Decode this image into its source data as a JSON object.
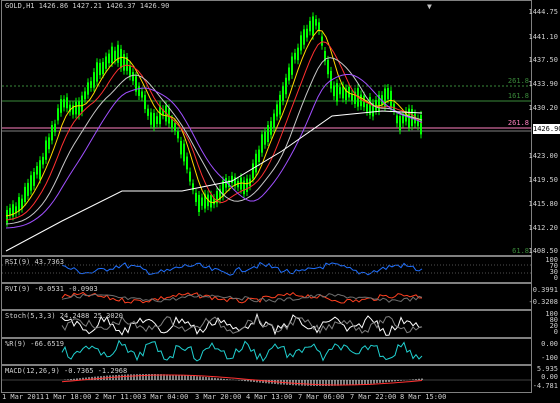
{
  "window": {
    "symbol_line": "GOLD,H1  1426.86 1427.21 1426.37 1426.90"
  },
  "price_axis": {
    "labels": [
      "1444.75",
      "1441.10",
      "1437.50",
      "1433.90",
      "1430.20",
      "1426.90",
      "1423.00",
      "1419.50",
      "1415.80",
      "1412.20",
      "1408.50"
    ],
    "current_price": "1426.90"
  },
  "fib_levels": {
    "top": "261.8",
    "mid": "161.8",
    "lower": "261.8",
    "bottom": "61.8"
  },
  "indicators": {
    "rsi": {
      "label": "RSI(9) 43.7363",
      "axis": [
        "100",
        "70",
        "30",
        "0"
      ]
    },
    "rvi": {
      "label": "RVI(9) -0.0531 -0.0903",
      "axis": [
        "0.3991",
        "-0.3208"
      ]
    },
    "stoch": {
      "label": "Stoch(5,3,3) 24.2488 25.3020",
      "axis": [
        "100",
        "80",
        "20",
        "0"
      ]
    },
    "wpr": {
      "label": "%R(9) -66.6519",
      "axis": [
        "0.00",
        "-100"
      ]
    },
    "macd": {
      "label": "MACD(12,26,9) -0.7365 -1.2968",
      "axis": [
        "5.935",
        "0.00",
        "-4.781"
      ]
    }
  },
  "time_axis": [
    "1 Mar 2011",
    "1 Mar 18:00",
    "2 Mar 11:00",
    "3 Mar 04:00",
    "3 Mar 20:00",
    "4 Mar 13:00",
    "7 Mar 06:00",
    "7 Mar 22:00",
    "8 Mar 15:00"
  ],
  "colors": {
    "background": "#000000",
    "candle": "#00ff00",
    "ma_white": "#ffffff",
    "ma_yellow": "#ffd700",
    "ma_red": "#ff3030",
    "ma_purple": "#a050ff",
    "fib_line": "#3a8a3a",
    "fib_pink": "#ff80c0",
    "rsi_line": "#2070ff",
    "rvi_main": "#ff4020",
    "stoch_line": "#ffffff",
    "wpr_line": "#20d0d0",
    "macd_hist": "#ffffff",
    "macd_signal": "#ff3030"
  }
}
